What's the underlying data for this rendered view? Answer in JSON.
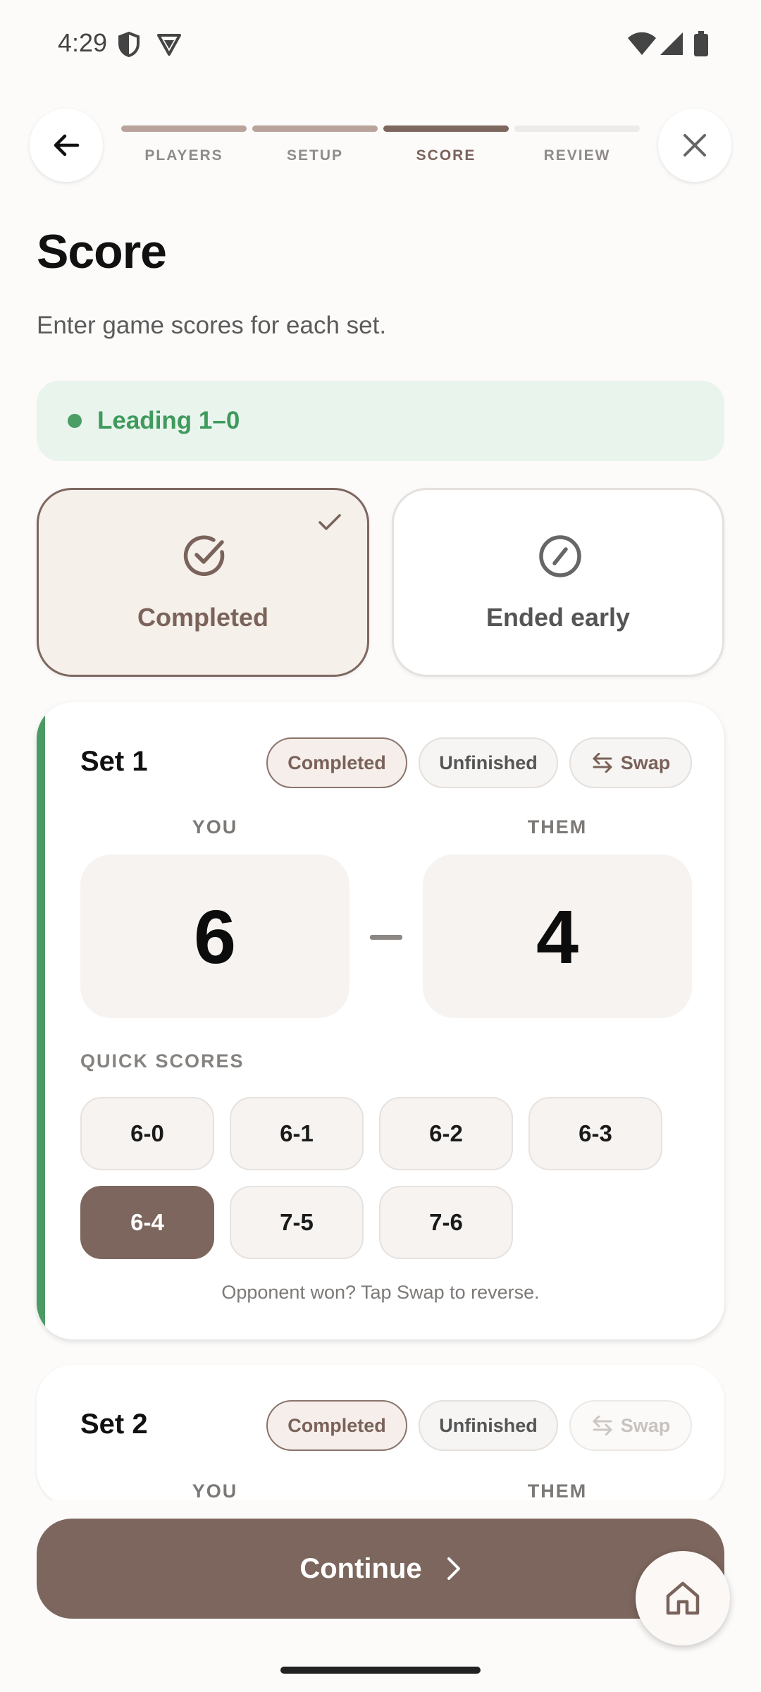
{
  "status_bar": {
    "time": "4:29"
  },
  "stepper": {
    "steps": [
      {
        "label": "PLAYERS",
        "state": "done"
      },
      {
        "label": "SETUP",
        "state": "done"
      },
      {
        "label": "SCORE",
        "state": "current"
      },
      {
        "label": "REVIEW",
        "state": "pending"
      }
    ]
  },
  "page": {
    "title": "Score",
    "subtitle": "Enter game scores for each set."
  },
  "lead_banner": {
    "text": "Leading 1–0",
    "color": "#3f9a5d"
  },
  "outcome": {
    "completed_label": "Completed",
    "ended_early_label": "Ended early",
    "selected": "Completed"
  },
  "sets": [
    {
      "title": "Set 1",
      "status_options": [
        "Completed",
        "Unfinished"
      ],
      "selected_status": "Completed",
      "swap_label": "Swap",
      "you_label": "YOU",
      "them_label": "THEM",
      "you_score": "6",
      "them_score": "4",
      "quick_scores_label": "QUICK SCORES",
      "quick_scores": [
        "6-0",
        "6-1",
        "6-2",
        "6-3",
        "6-4",
        "7-5",
        "7-6"
      ],
      "selected_quick_score": "6-4",
      "hint": "Opponent won? Tap Swap to reverse."
    },
    {
      "title": "Set 2",
      "status_options": [
        "Completed",
        "Unfinished"
      ],
      "selected_status": "Completed",
      "swap_label": "Swap",
      "swap_disabled": true,
      "you_label": "YOU",
      "them_label": "THEM"
    }
  ],
  "actions": {
    "continue_label": "Continue"
  },
  "colors": {
    "accent": "#7c665d",
    "success": "#4a9d64",
    "background": "#fcfbfa"
  }
}
